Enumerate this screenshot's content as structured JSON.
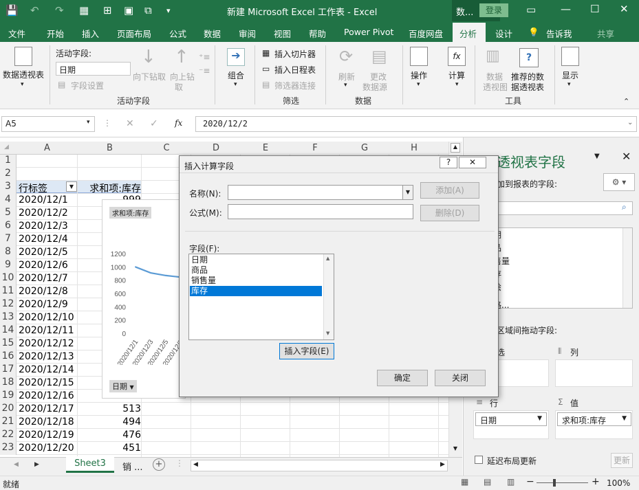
{
  "titlebar": {
    "title": "新建 Microsoft Excel 工作表  -  Excel",
    "context": "数...",
    "login": "登录"
  },
  "menu": [
    "文件",
    "开始",
    "插入",
    "页面布局",
    "公式",
    "数据",
    "审阅",
    "视图",
    "帮助",
    "Power Pivot",
    "百度网盘",
    "分析",
    "设计",
    "告诉我",
    "共享"
  ],
  "ribbon": {
    "pivot_table": "数据透视表",
    "active_field_label": "活动字段:",
    "active_field_value": "日期",
    "field_settings": "字段设置",
    "drill_down": "向下钻取",
    "drill_up": "向上钻",
    "drill_up2": "取",
    "group": "组合",
    "insert_slicer": "插入切片器",
    "insert_timeline": "插入日程表",
    "filter_connections": "筛选器连接",
    "refresh": "刷新",
    "change_source": "更改",
    "change_source2": "数据源",
    "actions": "操作",
    "calculations": "计算",
    "pivotchart": "数据",
    "pivotchart2": "透视图",
    "recommended": "推荐的数",
    "recommended2": "据透视表",
    "show": "显示",
    "groups": [
      "活动字段",
      "筛选",
      "数据",
      "工具"
    ]
  },
  "formula": {
    "namebox": "A5",
    "fx": "fx",
    "value": "2020/12/2"
  },
  "grid": {
    "columns": [
      "A",
      "B",
      "C",
      "D",
      "E",
      "F",
      "G",
      "H"
    ],
    "header_row": {
      "a": "行标签",
      "b": "求和项:库存"
    },
    "rows": [
      {
        "n": "1",
        "a": "",
        "b": ""
      },
      {
        "n": "2",
        "a": "",
        "b": ""
      },
      {
        "n": "3",
        "a": "行标签",
        "b": "求和项:库存"
      },
      {
        "n": "4",
        "a": "2020/12/1",
        "b": "999"
      },
      {
        "n": "5",
        "a": "2020/12/2",
        "b": ""
      },
      {
        "n": "6",
        "a": "2020/12/3",
        "b": ""
      },
      {
        "n": "7",
        "a": "2020/12/4",
        "b": ""
      },
      {
        "n": "8",
        "a": "2020/12/5",
        "b": ""
      },
      {
        "n": "9",
        "a": "2020/12/6",
        "b": ""
      },
      {
        "n": "10",
        "a": "2020/12/7",
        "b": ""
      },
      {
        "n": "11",
        "a": "2020/12/8",
        "b": ""
      },
      {
        "n": "12",
        "a": "2020/12/9",
        "b": ""
      },
      {
        "n": "13",
        "a": "2020/12/10",
        "b": ""
      },
      {
        "n": "14",
        "a": "2020/12/11",
        "b": ""
      },
      {
        "n": "15",
        "a": "2020/12/12",
        "b": ""
      },
      {
        "n": "16",
        "a": "2020/12/13",
        "b": ""
      },
      {
        "n": "17",
        "a": "2020/12/14",
        "b": ""
      },
      {
        "n": "18",
        "a": "2020/12/15",
        "b": ""
      },
      {
        "n": "19",
        "a": "2020/12/16",
        "b": "527"
      },
      {
        "n": "20",
        "a": "2020/12/17",
        "b": "513"
      },
      {
        "n": "21",
        "a": "2020/12/18",
        "b": "494"
      },
      {
        "n": "22",
        "a": "2020/12/19",
        "b": "476"
      },
      {
        "n": "23",
        "a": "2020/12/20",
        "b": "451"
      }
    ]
  },
  "chart": {
    "series_label": "求和项:库存",
    "field_button": "日期",
    "chart_data": {
      "type": "line",
      "x": [
        "2020/12/1",
        "2020/12/3",
        "2020/12/5",
        "2020/12/7"
      ],
      "series": [
        {
          "values": [
            999,
            910,
            870,
            845
          ]
        }
      ],
      "yticks": [
        "1200",
        "1000",
        "800",
        "600",
        "400",
        "200",
        "0"
      ],
      "ylim": [
        0,
        1200
      ],
      "color": "#5b9bd5"
    }
  },
  "sheets": {
    "active": "Sheet3",
    "other": "销 ..."
  },
  "status": {
    "ready": "就绪",
    "zoom": "100%"
  },
  "pane": {
    "title": "数据透视表字段",
    "choose_label": "添加到报表的字段:",
    "fields": [
      "期",
      "品",
      "售量",
      "存",
      "绘",
      "格..."
    ],
    "drag_label": "下区域间拖动字段:",
    "filters": "筛选",
    "columns": "列",
    "rows": "行",
    "values": "值",
    "row_item": "日期",
    "value_item": "求和项:库存",
    "defer": "延迟布局更新",
    "update": "更新"
  },
  "dialog": {
    "title": "插入计算字段",
    "name_label": "名称(N):",
    "formula_label": "公式(M):",
    "name_value": "",
    "formula_value": "",
    "add": "添加(A)",
    "delete": "删除(D)",
    "fields_label": "字段(F):",
    "fields": [
      "日期",
      "商品",
      "销售量",
      "库存"
    ],
    "selected_index": 3,
    "insert_field": "插入字段(E)",
    "ok": "确定",
    "close": "关闭"
  }
}
